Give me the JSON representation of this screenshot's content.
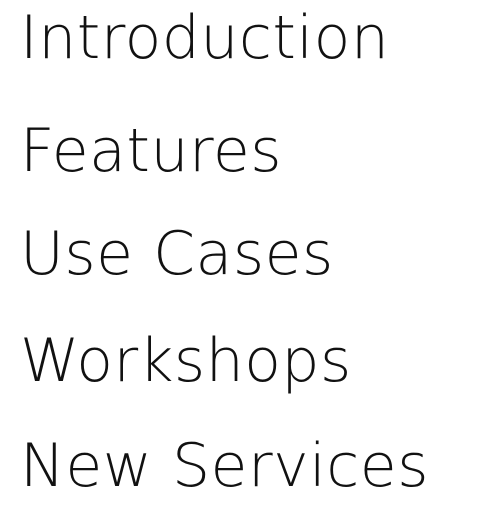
{
  "menu": {
    "items": [
      {
        "label": "Introduction"
      },
      {
        "label": "Features"
      },
      {
        "label": "Use Cases"
      },
      {
        "label": "Workshops"
      },
      {
        "label": "New Services"
      }
    ]
  },
  "colors": {
    "text": "#111111",
    "background": "#ffffff"
  }
}
